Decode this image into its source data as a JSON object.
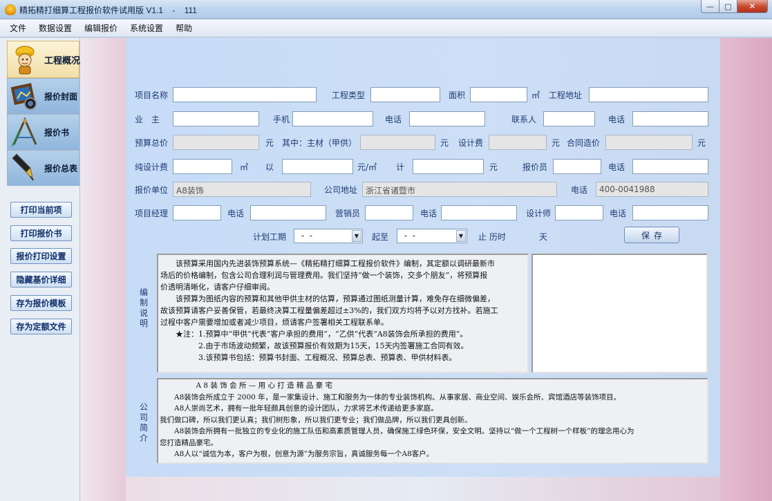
{
  "window": {
    "title": "精拓精打细算工程报价软件试用版 V1.1    -    111",
    "min_glyph": "—",
    "max_glyph": "□",
    "close_glyph": "✕"
  },
  "menu": [
    "文件",
    "数据设置",
    "编辑报价",
    "系统设置",
    "帮助"
  ],
  "nav": [
    {
      "label": "工程概况",
      "icon": "worker-icon",
      "active": true
    },
    {
      "label": "报价封面",
      "icon": "picture-frame-icon",
      "active": false
    },
    {
      "label": "报价书",
      "icon": "drafting-compass-icon",
      "active": false
    },
    {
      "label": "报价总表",
      "icon": "fountain-pen-icon",
      "active": false
    }
  ],
  "side_buttons": [
    "打印当前项",
    "打印报价书",
    "报价打印设置",
    "隐藏基价详细",
    "存为报价模板",
    "存为定额文件"
  ],
  "form": {
    "project_name": "项目名称",
    "project_type": "工程类型",
    "area": "面积",
    "sqm": "㎡",
    "project_address": "工程地址",
    "owner": "业　主",
    "mobile": "手机",
    "phone": "电话",
    "contact": "联系人",
    "phone2": "电话",
    "budget_total": "预算总价",
    "yuan1": "元",
    "main_material": "其中：主材（甲供）",
    "yuan2": "元",
    "design_fee": "设计费",
    "yuan3": "元",
    "contract_price": "合同造价",
    "yuan4": "元",
    "pure_design_fee": "纯设计费",
    "sqm2": "㎡",
    "by": "以",
    "yuan_per_sqm": "元/㎡",
    "total": "计",
    "yuan5": "元",
    "quoter": "报价员",
    "phone3": "电话",
    "quote_unit": "报价单位",
    "quote_unit_value": "A8装饰",
    "company_address": "公司地址",
    "company_address_value": "浙江省诸暨市",
    "phone4": "电话",
    "phone4_value": "400-0041988",
    "pm": "项目经理",
    "phone5": "电话",
    "sales": "营销员",
    "phone6": "电话",
    "designer": "设计师",
    "phone7": "电话",
    "plan_period": "计划工期",
    "start_date": " -  - ",
    "to": "起至",
    "end_date": " -  - ",
    "stop_duration": "止 历时",
    "days": "天",
    "save": "保存"
  },
  "notes": {
    "label_chars": [
      "编",
      "制",
      "说",
      "明"
    ],
    "lines": [
      "　　该预算采用国内先进装饰预算系统—《精拓精打细算工程报价软件》编制，其定额以调研最新市",
      "场后的价格编制，包含公司合理利润与管理费用。我们坚持“做一个装饰，交多个朋友”，将预算报",
      "价透明清晰化，请客户仔细审阅。",
      "　　该预算为图纸内容的预算和其他甲供主材的估算，预算通过图纸测量计算，难免存在细微偏差，",
      "故该预算请客户妥善保管，若最终决算工程量偏差超过±3%的，我们双方均将予以对方找补。若施工",
      "过程中客户需要增加或者减少项目，烦请客户签署相关工程联系单。",
      "　　★注：1.预算中“甲供”代表“客户承担的费用”，“乙供”代表“A8装饰会所承担的费用”。",
      "　　　　　2.由于市场波动频繁，故该预算报价有效期为15天，15天内签署施工合同有效。",
      "　　　　　3.该预算书包括：预算书封面、工程概况、预算总表、预算表、甲供材料表。"
    ]
  },
  "company": {
    "label_chars": [
      "公",
      "司",
      "简",
      "介"
    ],
    "lines": [
      "　　　　　A 8 装 饰 会 所 — 用 心 打 造 精 品 豪 宅",
      "　　A8装饰会所成立于 2000 年，是一家集设计、施工和服务为一体的专业装饰机构。从事家居、商业空间、娱乐会所、宾馆酒店等装饰项目。",
      "　　A8人崇尚艺术，拥有一批年轻颇具创意的设计团队，力求将艺术传递给更多家庭。",
      "我们做口碑，所以我们更认真；我们树形象，所以我们更专业；我们做品牌，所以我们更具创新。",
      "　　A8装饰会所拥有一批独立的专业化的施工队伍和高素质管理人员，确保施工绿色环保，安全文明。坚持以“做一个工程树一个样板”的理念用心为",
      "您打造精品豪宅。",
      "　　A8人以“诚信为本，客户为根，创意为源”为服务宗旨，真诚服务每一个A8客户。"
    ]
  }
}
